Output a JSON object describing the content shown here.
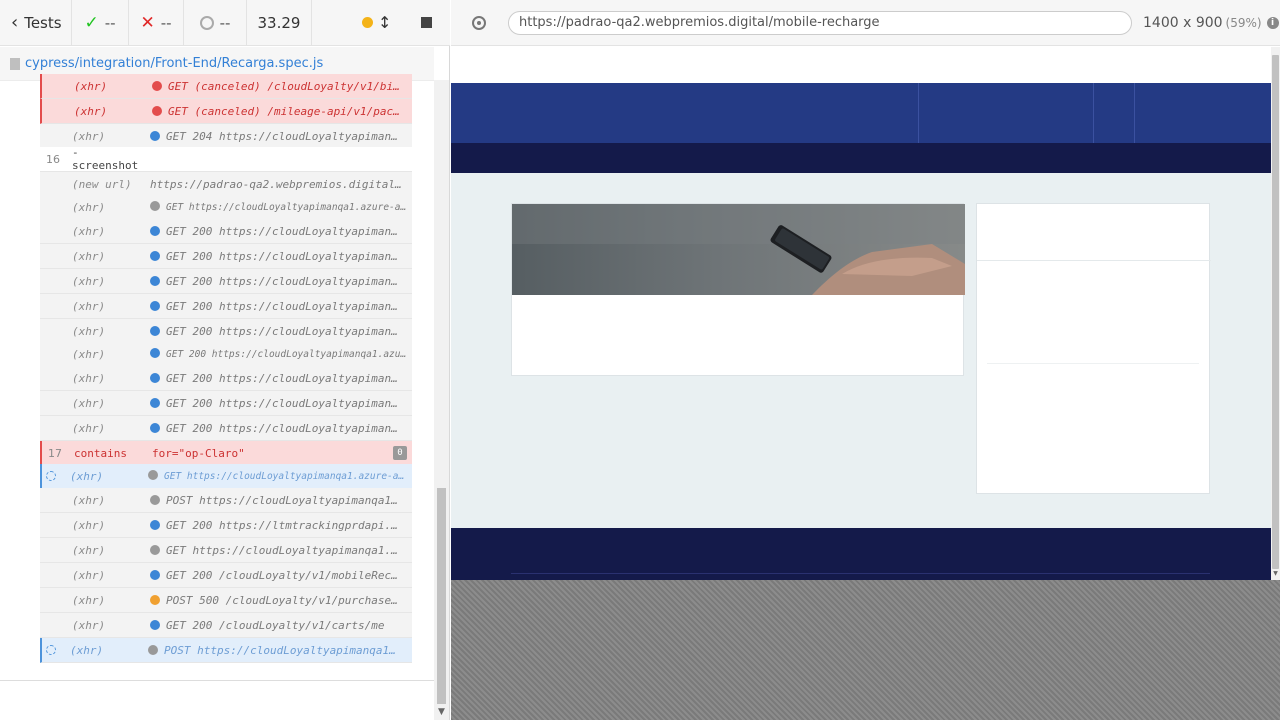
{
  "reporter": {
    "tests_label": "Tests",
    "passed": "--",
    "failed": "--",
    "pending": "--",
    "duration": "33.29",
    "spec_path": "cypress/integration/Front-End/Recarga.spec.js"
  },
  "commands": [
    {
      "num": "",
      "name": "(xhr)",
      "msg": "GET (canceled) /cloudLoyalty/v1/bi…",
      "state": "canceled",
      "indicator": "#e34c4c"
    },
    {
      "num": "",
      "name": "(xhr)",
      "msg": "GET (canceled) /mileage-api/v1/pac…",
      "state": "canceled",
      "indicator": "#e34c4c"
    },
    {
      "num": "",
      "name": "(xhr)",
      "msg": "GET 204 https://cloudLoyaltyapiman…",
      "state": "default",
      "indicator": "#3c86d6"
    },
    {
      "num": "16",
      "name": "- screenshot",
      "msg": "",
      "state": "cmd",
      "indicator": ""
    },
    {
      "num": "",
      "name": "(new url)",
      "msg": "https://padrao-qa2.webpremios.digital…",
      "state": "default",
      "indicator": ""
    },
    {
      "num": "",
      "name": "(xhr)",
      "msg": "GET https://cloudLoyaltyapimanqa1.azure-a…",
      "state": "small",
      "indicator": "#999999"
    },
    {
      "num": "",
      "name": "(xhr)",
      "msg": "GET 200 https://cloudLoyaltyapiman…",
      "state": "default",
      "indicator": "#3c86d6"
    },
    {
      "num": "",
      "name": "(xhr)",
      "msg": "GET 200 https://cloudLoyaltyapiman…",
      "state": "default",
      "indicator": "#3c86d6"
    },
    {
      "num": "",
      "name": "(xhr)",
      "msg": "GET 200 https://cloudLoyaltyapiman…",
      "state": "default",
      "indicator": "#3c86d6"
    },
    {
      "num": "",
      "name": "(xhr)",
      "msg": "GET 200 https://cloudLoyaltyapiman…",
      "state": "default",
      "indicator": "#3c86d6"
    },
    {
      "num": "",
      "name": "(xhr)",
      "msg": "GET 200 https://cloudLoyaltyapiman…",
      "state": "default",
      "indicator": "#3c86d6"
    },
    {
      "num": "",
      "name": "(xhr)",
      "msg": "GET 200 https://cloudLoyaltyapimanqa1.azu…",
      "state": "small",
      "indicator": "#3c86d6"
    },
    {
      "num": "",
      "name": "(xhr)",
      "msg": "GET 200 https://cloudLoyaltyapiman…",
      "state": "default",
      "indicator": "#3c86d6"
    },
    {
      "num": "",
      "name": "(xhr)",
      "msg": "GET 200 https://cloudLoyaltyapiman…",
      "state": "default",
      "indicator": "#3c86d6"
    },
    {
      "num": "",
      "name": "(xhr)",
      "msg": "GET 200 https://cloudLoyaltyapiman…",
      "state": "default",
      "indicator": "#3c86d6"
    },
    {
      "num": "17",
      "name": "contains",
      "msg": "for=\"op-Claro\"",
      "state": "failed",
      "indicator": "",
      "badge": "0"
    },
    {
      "num": "",
      "name": "(xhr)",
      "msg": "GET https://cloudLoyaltyapimanqa1.azure-a…",
      "state": "pend-small",
      "indicator": "#999999"
    },
    {
      "num": "",
      "name": "(xhr)",
      "msg": "POST https://cloudLoyaltyapimanqa1…",
      "state": "default",
      "indicator": "#999999"
    },
    {
      "num": "",
      "name": "(xhr)",
      "msg": "GET 200 https://ltmtrackingprdapi.…",
      "state": "default",
      "indicator": "#3c86d6"
    },
    {
      "num": "",
      "name": "(xhr)",
      "msg": "GET https://cloudLoyaltyapimanqa1.…",
      "state": "default",
      "indicator": "#999999"
    },
    {
      "num": "",
      "name": "(xhr)",
      "msg": "GET 200 /cloudLoyalty/v1/mobileRec…",
      "state": "default",
      "indicator": "#3c86d6"
    },
    {
      "num": "",
      "name": "(xhr)",
      "msg": "POST 500 /cloudLoyalty/v1/purchase…",
      "state": "default",
      "indicator": "#f0a030"
    },
    {
      "num": "",
      "name": "(xhr)",
      "msg": "GET 200 /cloudLoyalty/v1/carts/me",
      "state": "default",
      "indicator": "#3c86d6"
    },
    {
      "num": "",
      "name": "(xhr)",
      "msg": "POST https://cloudLoyaltyapimanqa1…",
      "state": "pend",
      "indicator": "#999999"
    }
  ],
  "aut": {
    "url": "https://padrao-qa2.webpremios.digital/mobile-recharge",
    "viewport": "1400 x 900",
    "scale": "(59%)"
  }
}
